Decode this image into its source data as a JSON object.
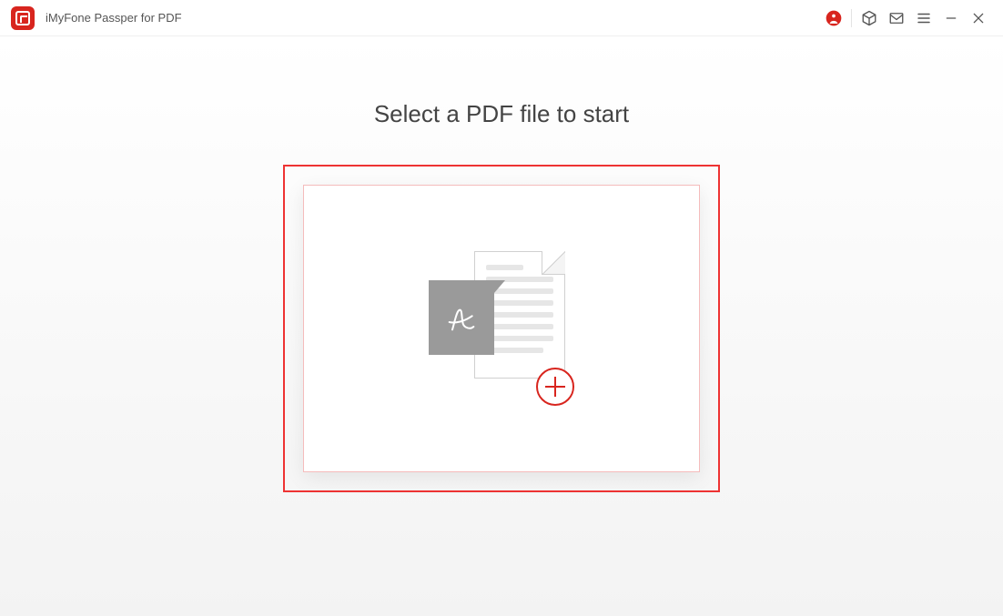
{
  "titlebar": {
    "app_name": "iMyFone Passper for PDF"
  },
  "main": {
    "heading": "Select a PDF file to start"
  },
  "icons": {
    "account": "account-icon",
    "box": "box-icon",
    "mail": "mail-icon",
    "menu": "menu-icon",
    "minimize": "minimize-icon",
    "close": "close-icon"
  },
  "colors": {
    "brand_red": "#d8251e",
    "highlight_border": "#ee3333"
  }
}
